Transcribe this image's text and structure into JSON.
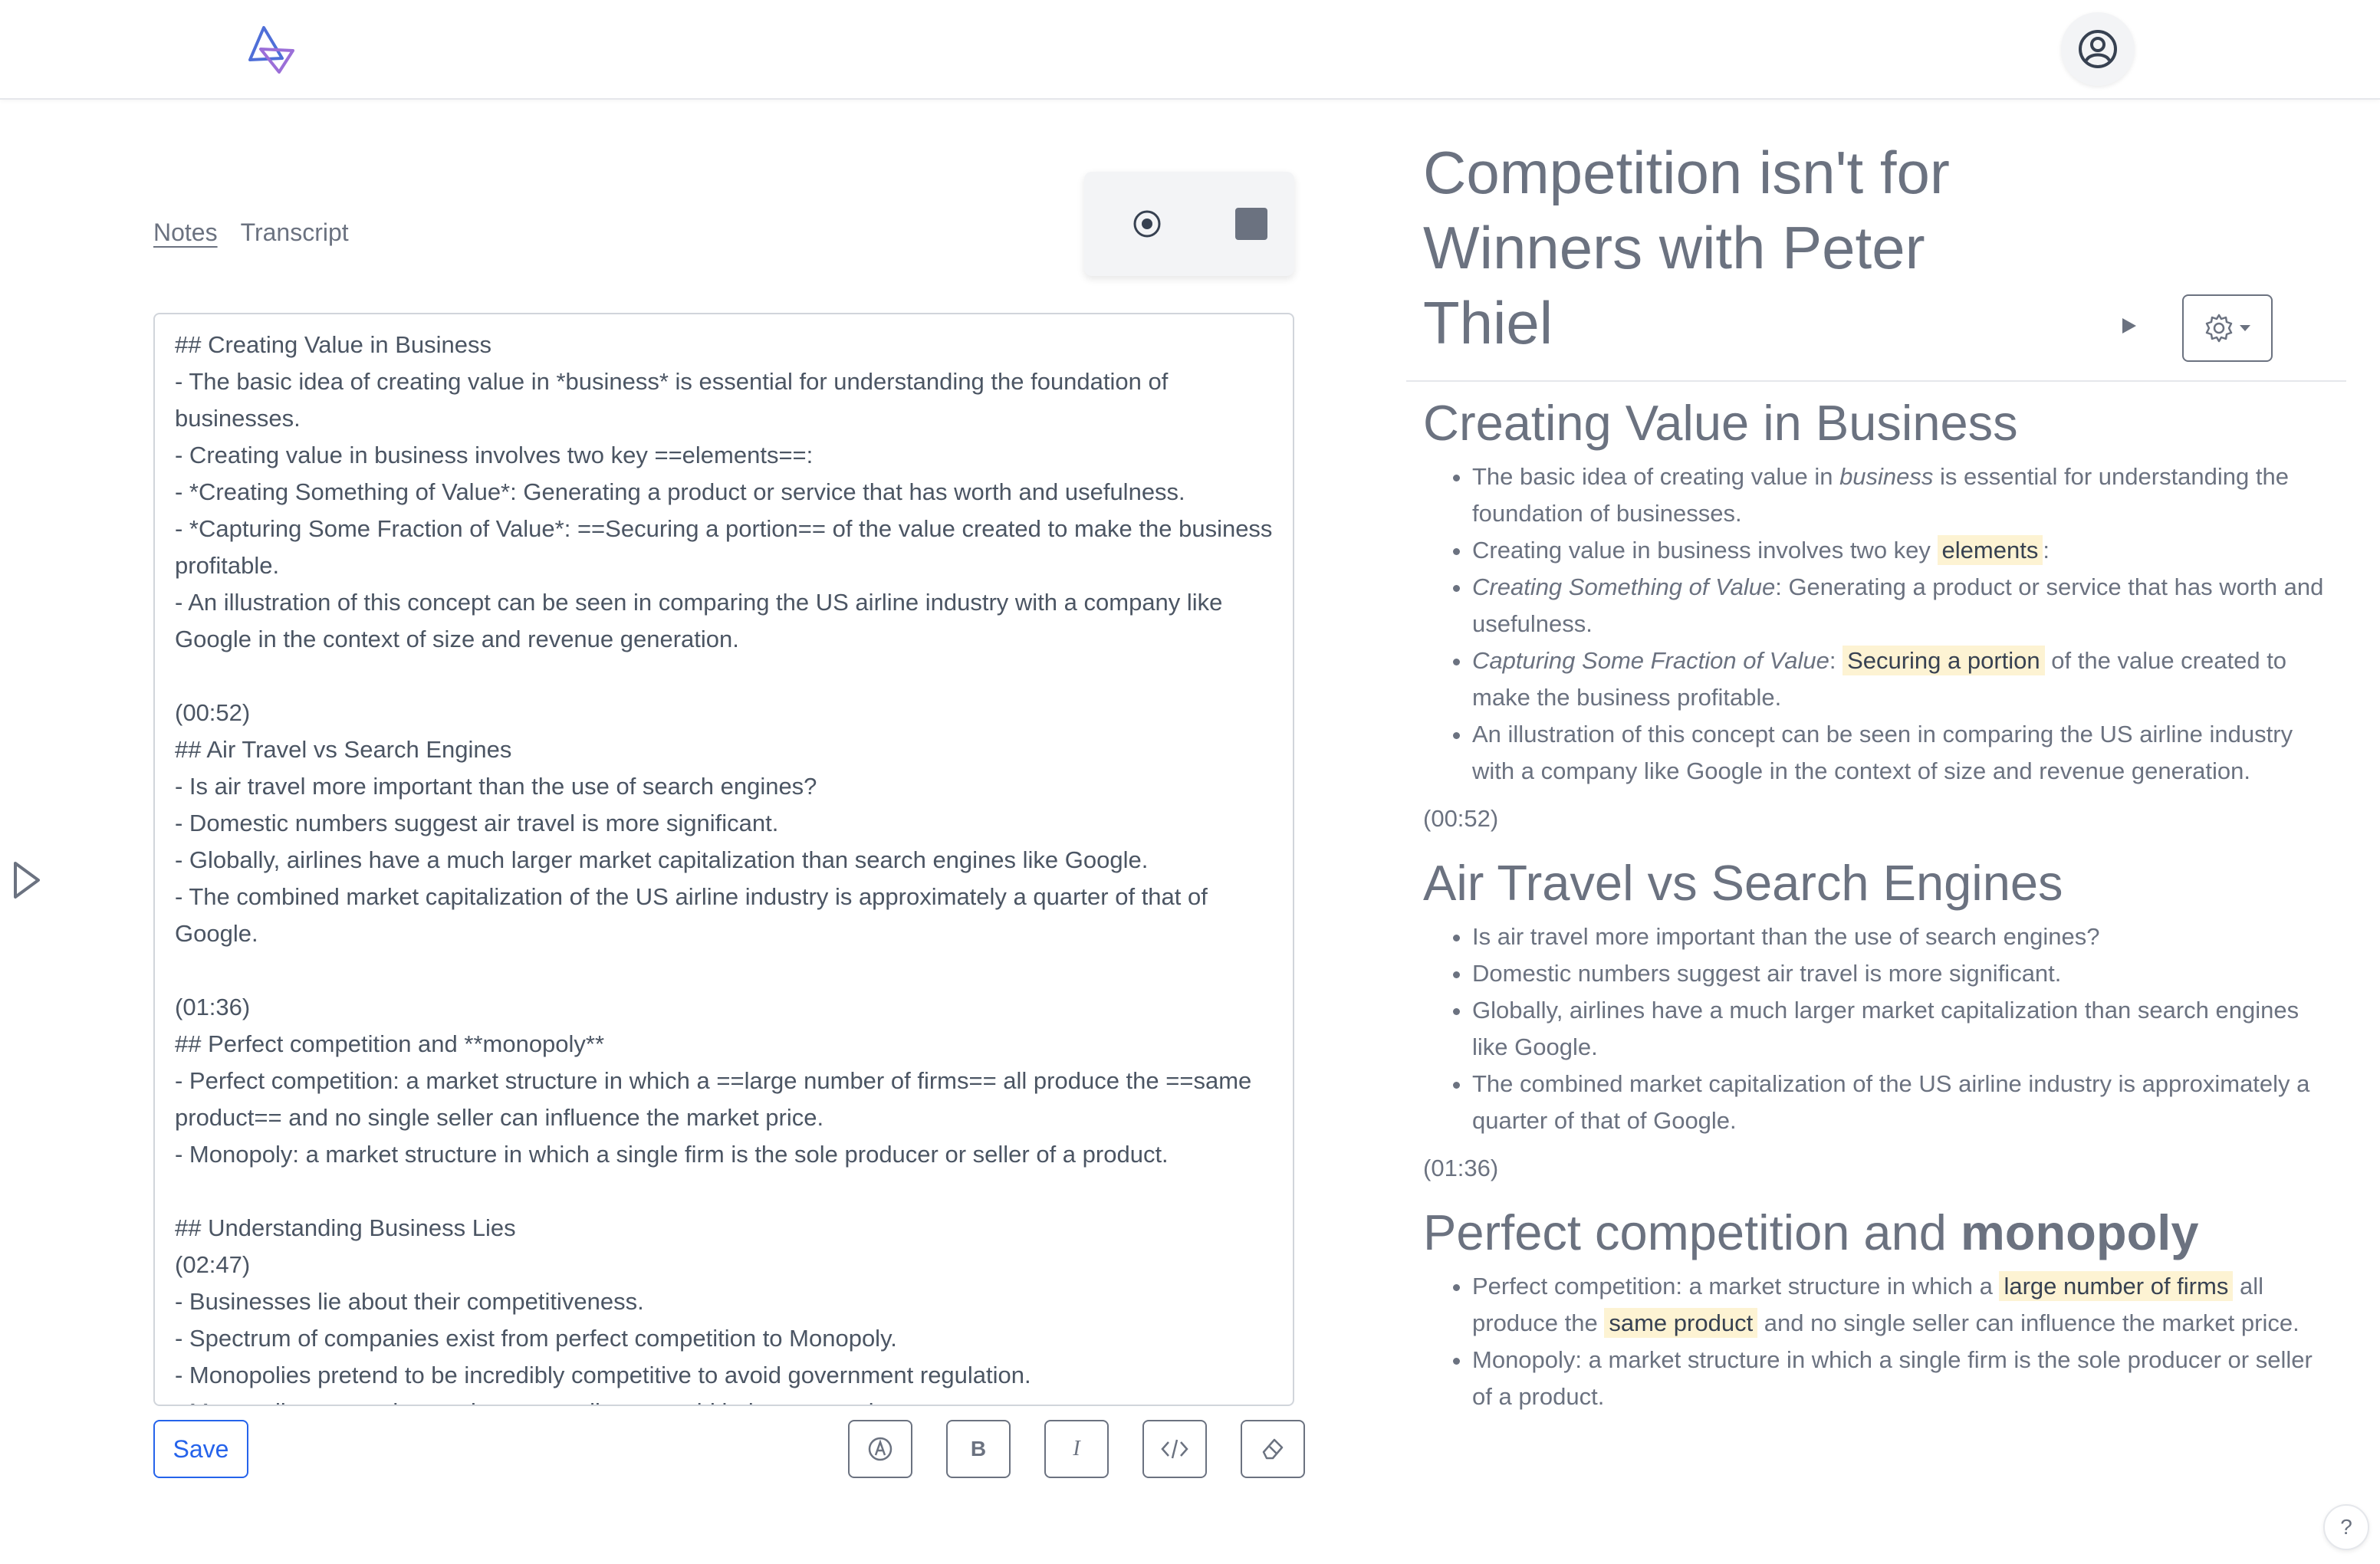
{
  "app": {
    "logo_icon": "triangle-knot-logo",
    "accent": "#2563eb",
    "highlight": "#fdf3d3"
  },
  "tabs": [
    {
      "label": "Notes",
      "active": true
    },
    {
      "label": "Transcript",
      "active": false
    }
  ],
  "editor": {
    "content": "## Creating Value in Business\n- The basic idea of creating value in *business* is essential for understanding the foundation of businesses.\n- Creating value in business involves two key ==elements==:\n- *Creating Something of Value*: Generating a product or service that has worth and usefulness.\n- *Capturing Some Fraction of Value*: ==Securing a portion== of the value created to make the business profitable.\n- An illustration of this concept can be seen in comparing the US airline industry with a company like Google in the context of size and revenue generation.\n\n(00:52)\n## Air Travel vs Search Engines\n- Is air travel more important than the use of search engines?\n- Domestic numbers suggest air travel is more significant.\n- Globally, airlines have a much larger market capitalization than search engines like Google.\n- The combined market capitalization of the US airline industry is approximately a quarter of that of Google.\n\n(01:36)\n## Perfect competition and **monopoly**\n- Perfect competition: a market structure in which a ==large number of firms== all produce the ==same product== and no single seller can influence the market price.\n- Monopoly: a market structure in which a single firm is the sole producer or seller of a product.\n\n## Understanding Business Lies\n(02:47)\n- Businesses lie about their competitiveness.\n- Spectrum of companies exist from perfect competition to Monopoly.\n- Monopolies pretend to be incredibly competitive to avoid government regulation.\n- Monopolies pretend not to be monopolies to avoid being targeted."
  },
  "toolbar": {
    "save_label": "Save",
    "bold_label": "B",
    "italic_label": "I"
  },
  "preview": {
    "title": "Competition isn't for Winners with Peter Thiel",
    "s1": {
      "heading": "Creating Value in Business",
      "b1_pre": "The basic idea of creating value in ",
      "b1_em": "business",
      "b1_post": " is essential for understanding the foundation of businesses.",
      "b2_pre": "Creating value in business involves two key ",
      "b2_hl": "elements",
      "b2_post": ":",
      "b3_em": "Creating Something of Value",
      "b3_post": ": Generating a product or service that has worth and usefulness.",
      "b4_em": "Capturing Some Fraction of Value",
      "b4_mid": ": ",
      "b4_hl": "Securing a portion",
      "b4_post": " of the value created to make the business profitable.",
      "b5": "An illustration of this concept can be seen in comparing the US airline industry with a company like Google in the context of size and revenue generation."
    },
    "ts1": "(00:52)",
    "s2": {
      "heading": "Air Travel vs Search Engines",
      "b1": "Is air travel more important than the use of search engines?",
      "b2": "Domestic numbers suggest air travel is more significant.",
      "b3": "Globally, airlines have a much larger market capitalization than search engines like Google.",
      "b4": "The combined market capitalization of the US airline industry is approximately a quarter of that of Google."
    },
    "ts2": "(01:36)",
    "s3": {
      "heading_pre": "Perfect competition and ",
      "heading_bold": "monopoly",
      "b1_pre": "Perfect competition: a market structure in which a ",
      "b1_hl1": "large number of firms",
      "b1_mid": " all produce the ",
      "b1_hl2": "same product",
      "b1_post": " and no single seller can influence the market price.",
      "b2": "Monopoly: a market structure in which a single firm is the sole producer or seller of a product."
    },
    "help_label": "?"
  }
}
